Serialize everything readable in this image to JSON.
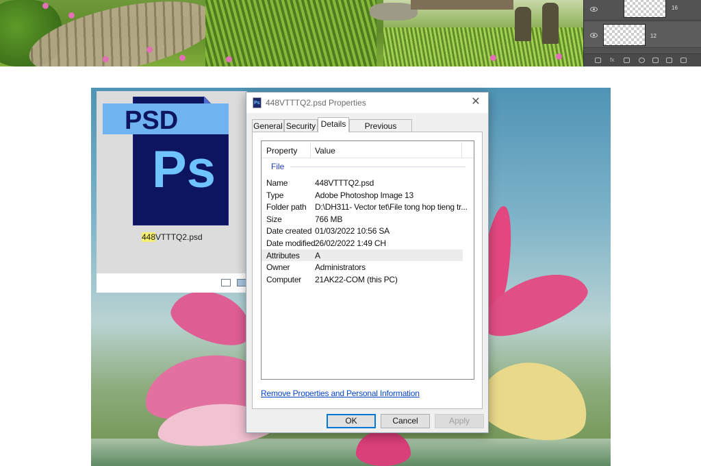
{
  "banner": {
    "description": ""
  },
  "layers_panel": {
    "rows": [
      {
        "number": "16"
      },
      {
        "number": "12"
      }
    ],
    "footer_icons": [
      "link-icon",
      "fx-icon",
      "mask-icon",
      "adjustment-icon",
      "folder-icon",
      "new-layer-icon",
      "trash-icon"
    ]
  },
  "explorer": {
    "file_name_highlight": "448",
    "file_name_rest": "VTTTQ2.psd",
    "icon": {
      "top_label": "PSD",
      "glyph": "Ps"
    }
  },
  "dialog": {
    "title": "448VTTTQ2.psd Properties",
    "close_glyph": "✕",
    "tabs": [
      "General",
      "Security",
      "Details",
      "Previous Versions"
    ],
    "active_tab": "Details",
    "columns": {
      "property": "Property",
      "value": "Value"
    },
    "group": "File",
    "rows": [
      {
        "key": "Name",
        "value": "448VTTTQ2.psd"
      },
      {
        "key": "Type",
        "value": "Adobe Photoshop Image 13"
      },
      {
        "key": "Folder path",
        "value": "D:\\DH311- Vector tet\\File tong hop tieng tr..."
      },
      {
        "key": "Size",
        "value": "766 MB"
      },
      {
        "key": "Date created",
        "value": "01/03/2022 10:56 SA"
      },
      {
        "key": "Date modified",
        "value": "26/02/2022 1:49 CH"
      },
      {
        "key": "Attributes",
        "value": "A"
      },
      {
        "key": "Owner",
        "value": "Administrators"
      },
      {
        "key": "Computer",
        "value": "21AK22-COM (this PC)"
      }
    ],
    "selected_row": "Attributes",
    "remove_link": "Remove Properties and Personal Information",
    "buttons": {
      "ok": "OK",
      "cancel": "Cancel",
      "apply": "Apply"
    }
  },
  "colors": {
    "dialog_bg": "#f0f0f0",
    "link": "#0645c7",
    "group_header": "#1e3bb3",
    "psd_blue_dark": "#0e1560",
    "psd_blue_light": "#6fc4ff",
    "ps_panel": "#535353",
    "lotus_pink": "#e2487f"
  }
}
